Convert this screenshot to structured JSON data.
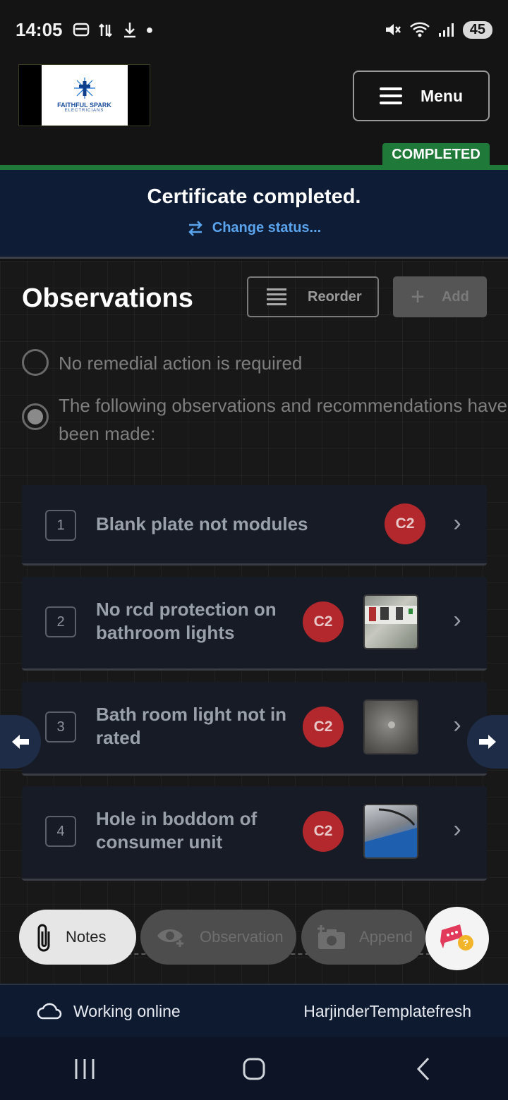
{
  "status_bar": {
    "time": "14:05",
    "battery": "45"
  },
  "header": {
    "logo_title": "FAITHFUL SPARK",
    "logo_subtitle": "ELECTRICIANS",
    "menu_label": "Menu",
    "status_tag": "COMPLETED"
  },
  "banner": {
    "title": "Certificate completed.",
    "change_status": "Change status..."
  },
  "observations": {
    "title": "Observations",
    "reorder_label": "Reorder",
    "add_label": "Add",
    "radio_options": [
      {
        "label": "No remedial action is required",
        "selected": false
      },
      {
        "label": "The following observations and recommendations have been made:",
        "selected": true
      }
    ],
    "items": [
      {
        "number": "1",
        "text": "Blank plate not modules",
        "code": "C2",
        "has_photo": false
      },
      {
        "number": "2",
        "text": "No rcd protection on bathroom lights",
        "code": "C2",
        "has_photo": true
      },
      {
        "number": "3",
        "text": "Bath room light not in rated",
        "code": "C2",
        "has_photo": true
      },
      {
        "number": "4",
        "text": "Hole in boddom of consumer unit",
        "code": "C2",
        "has_photo": true
      }
    ]
  },
  "actions": {
    "notes": "Notes",
    "observation": "Observation",
    "append": "Append"
  },
  "footer": {
    "connection": "Working online",
    "template": "HarjinderTemplatefresh"
  },
  "colors": {
    "accent_green": "#1f7a3a",
    "banner_bg": "#0e1c36",
    "badge_red": "#b3282d",
    "link_blue": "#5aa4ee"
  }
}
